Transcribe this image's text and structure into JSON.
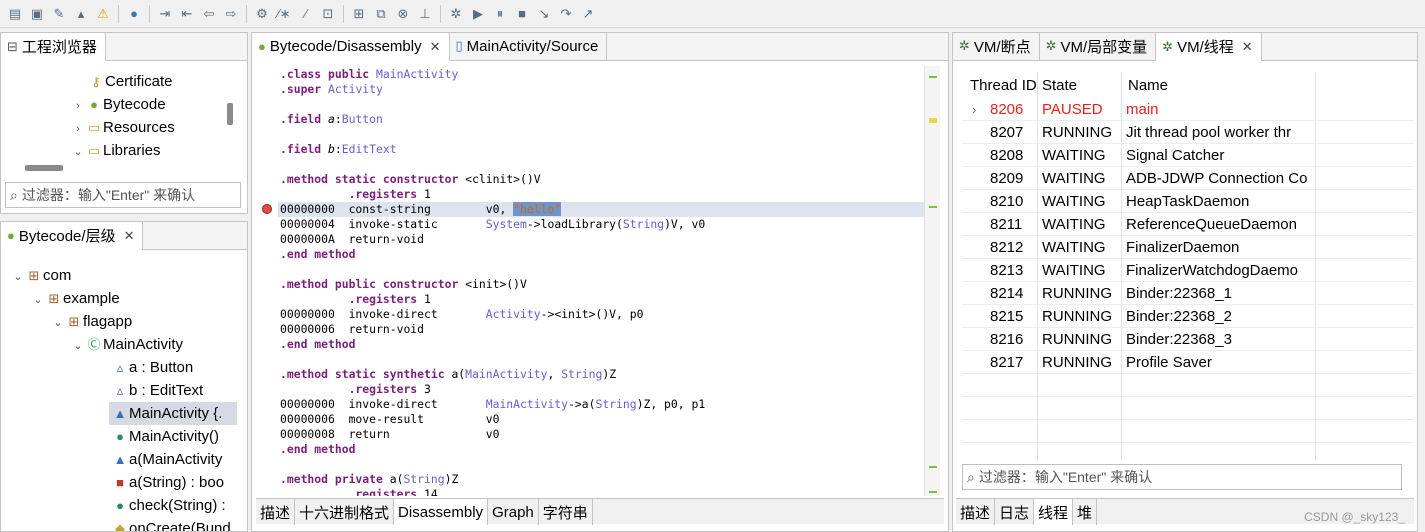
{
  "left_top_panel": {
    "tab_label": "工程浏览器",
    "items": [
      {
        "label": "Certificate",
        "icon": "key-icon"
      },
      {
        "label": "Bytecode",
        "icon": "android-icon"
      },
      {
        "label": "Resources",
        "icon": "folder-icon"
      },
      {
        "label": "Libraries",
        "icon": "folder-icon"
      }
    ],
    "filter_placeholder": "过滤器：输入\"Enter\" 来确认"
  },
  "hierarchy_panel": {
    "tab_label": "Bytecode/层级",
    "items": [
      {
        "label": "com"
      },
      {
        "label": "example"
      },
      {
        "label": "flagapp"
      },
      {
        "label": "MainActivity"
      },
      {
        "label": "a : Button"
      },
      {
        "label": "b : EditText"
      },
      {
        "label": "MainActivity {."
      },
      {
        "label": "MainActivity()"
      },
      {
        "label": "a(MainActivity"
      },
      {
        "label": "a(String) : boo"
      },
      {
        "label": "check(String) :"
      },
      {
        "label": "onCreate(Bund"
      }
    ]
  },
  "editor": {
    "tabs": [
      {
        "label": "Bytecode/Disassembly"
      },
      {
        "label": "MainActivity/Source"
      }
    ],
    "bottom_tabs": [
      "描述",
      "十六进制格式",
      "Disassembly",
      "Graph",
      "字符串"
    ],
    "active_bottom_tab": "Disassembly"
  },
  "vm_panel": {
    "tabs": [
      {
        "label": "VM/断点"
      },
      {
        "label": "VM/局部变量"
      },
      {
        "label": "VM/线程"
      }
    ],
    "columns": [
      "Thread ID",
      "State",
      "Name"
    ],
    "threads": [
      {
        "id": "8206",
        "state": "PAUSED",
        "name": "main"
      },
      {
        "id": "8207",
        "state": "RUNNING",
        "name": "Jit thread pool worker thr"
      },
      {
        "id": "8208",
        "state": "WAITING",
        "name": "Signal Catcher"
      },
      {
        "id": "8209",
        "state": "WAITING",
        "name": "ADB-JDWP Connection Co"
      },
      {
        "id": "8210",
        "state": "WAITING",
        "name": "HeapTaskDaemon"
      },
      {
        "id": "8211",
        "state": "WAITING",
        "name": "ReferenceQueueDaemon"
      },
      {
        "id": "8212",
        "state": "WAITING",
        "name": "FinalizerDaemon"
      },
      {
        "id": "8213",
        "state": "WAITING",
        "name": "FinalizerWatchdogDaemo"
      },
      {
        "id": "8214",
        "state": "RUNNING",
        "name": "Binder:22368_1"
      },
      {
        "id": "8215",
        "state": "RUNNING",
        "name": "Binder:22368_2"
      },
      {
        "id": "8216",
        "state": "RUNNING",
        "name": "Binder:22368_3"
      },
      {
        "id": "8217",
        "state": "RUNNING",
        "name": "Profile Saver"
      }
    ],
    "filter_placeholder": "过滤器：输入\"Enter\" 来确认",
    "bottom_tabs": [
      "描述",
      "日志",
      "线程",
      "堆"
    ],
    "active_bottom_tab": "线程"
  },
  "watermark": "CSDN @_sky123_",
  "colors": {
    "paused_red": "#e8211d",
    "keyword": "#7a1e7a",
    "type": "#6b5bd4",
    "string": "#d4641a"
  }
}
